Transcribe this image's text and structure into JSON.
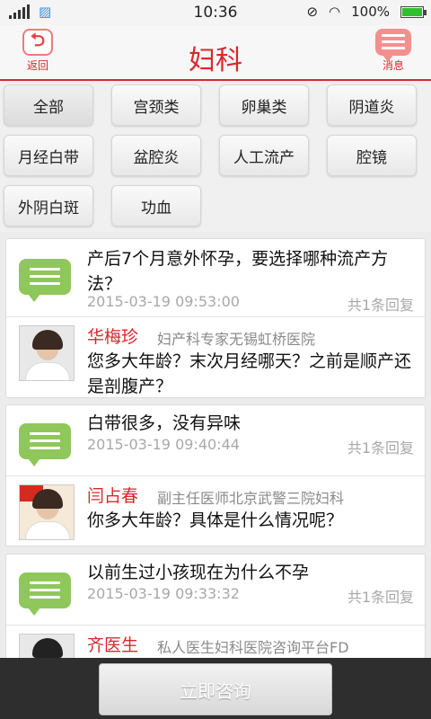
{
  "status_bar": {
    "time": "10:36",
    "battery": "100%",
    "icons": [
      "signal-icon",
      "image-icon",
      "mute-icon",
      "wifi-icon",
      "battery-icon"
    ]
  },
  "header": {
    "title": "妇科",
    "back_label": "返回",
    "message_label": "消息",
    "accent_color": "#d9272e"
  },
  "categories": [
    "全部",
    "宫颈类",
    "卵巢类",
    "阴道炎",
    "月经白带",
    "盆腔炎",
    "人工流产",
    "腔镜",
    "外阴白斑",
    "功血"
  ],
  "questions": [
    {
      "text": "产后7个月意外怀孕，要选择哪种流产方法？",
      "date": "2015-03-19 09:53:00",
      "reply_count": "共1条回复",
      "doctor_name": "华梅珍",
      "doctor_title": "妇产科专家无锡虹桥医院",
      "answer": "您多大年龄？末次月经哪天？之前是顺产还是剖腹产？"
    },
    {
      "text": "白带很多，没有异味",
      "date": "2015-03-19 09:40:44",
      "reply_count": "共1条回复",
      "doctor_name": "闫占春",
      "doctor_title": "副主任医师北京武警三院妇科",
      "answer": "你多大年龄？具体是什么情况呢？"
    },
    {
      "text": "以前生过小孩现在为什么不孕",
      "date": "2015-03-19 09:33:32",
      "reply_count": "共1条回复",
      "doctor_name": "齐医生",
      "doctor_title": "私人医生妇科医院咨询平台FD",
      "answer": ""
    }
  ],
  "bottom": {
    "consult_label": "立即咨询"
  }
}
